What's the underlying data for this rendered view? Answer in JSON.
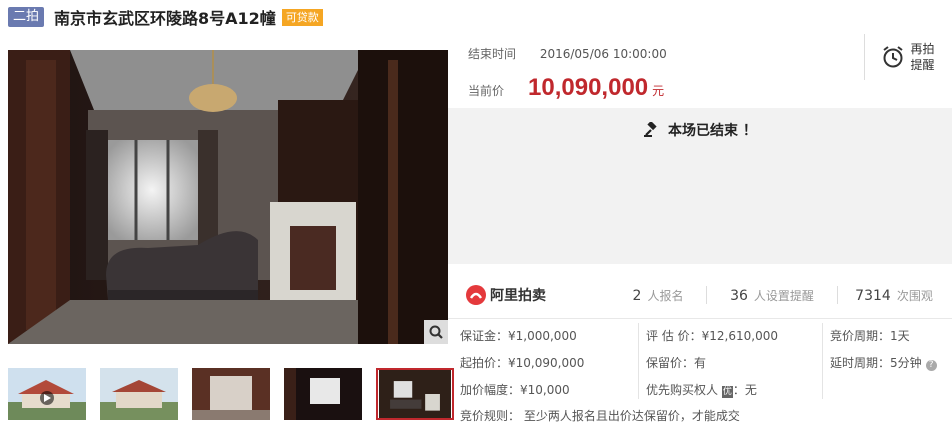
{
  "header": {
    "round_badge": "二拍",
    "title": "南京市玄武区环陵路8号A12幢",
    "loan_badge": "可贷款"
  },
  "auction": {
    "end_label": "结束时间",
    "end_time": "2016/05/06 10:00:00",
    "price_label": "当前价",
    "price": "10,090,000",
    "currency": "元",
    "remind_line1": "再拍",
    "remind_line2": "提醒",
    "ended_message": "本场已结束 ！"
  },
  "stats": {
    "brand": "阿里拍卖",
    "signups_num": "2",
    "signups_label": "人报名",
    "reminders_num": "36",
    "reminders_label": "人设置提醒",
    "views_num": "7314",
    "views_label": "次围观"
  },
  "info": {
    "deposit": "保证金：¥1,000,000",
    "start_price": "起拍价：¥10,090,000",
    "increment": "加价幅度：¥10,000",
    "valuation": "评 估 价：¥12,610,000",
    "reserve": "保留价：有",
    "priority_label": "优先购买权人",
    "priority_value": "：无",
    "cycle": "竞价周期：1天",
    "delay": "延时周期：5分钟",
    "rules": "竞价规则：   至少两人报名且出价达保留价，才能成交"
  },
  "colors": {
    "accent": "#c0282d",
    "round_badge": "#6a7ab0",
    "loan_badge": "#f5a623"
  },
  "icons": [
    "alarm-clock-icon",
    "gavel-icon",
    "ali-auction-logo-icon",
    "zoom-icon",
    "help-icon",
    "play-icon"
  ]
}
